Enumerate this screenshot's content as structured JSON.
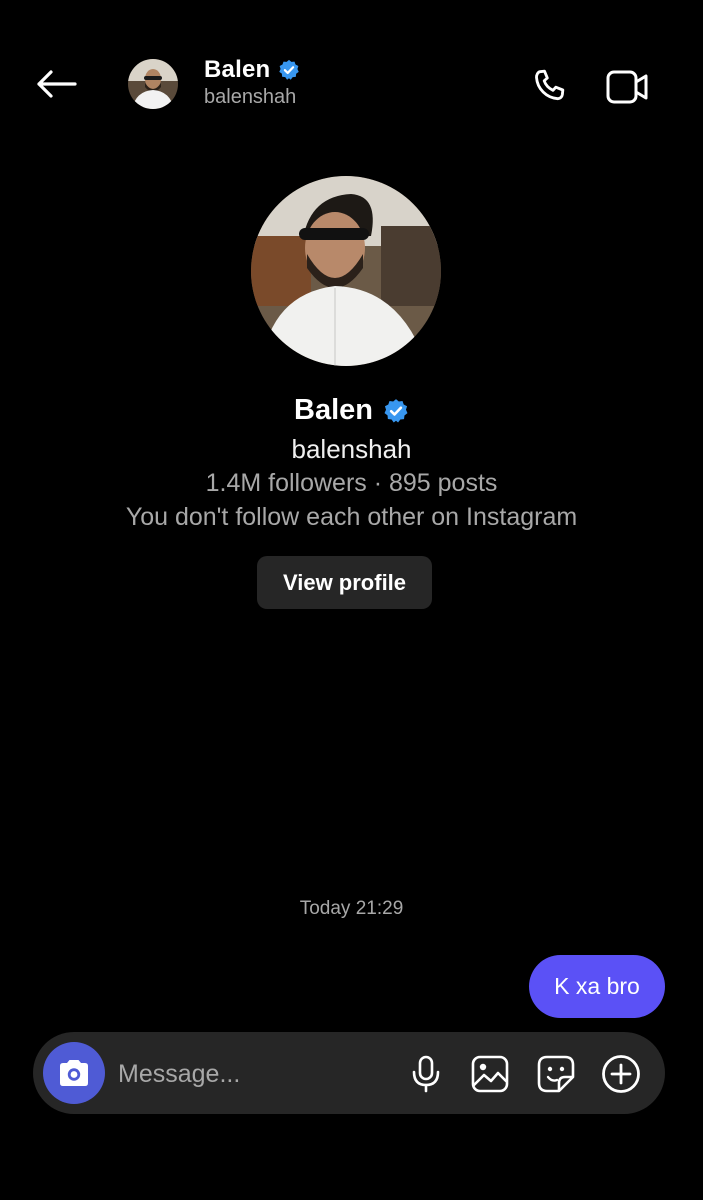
{
  "header": {
    "name": "Balen",
    "username": "balenshah",
    "icons": {
      "back": "arrow-left-icon",
      "verified": "verified-badge-icon",
      "call": "phone-icon",
      "video": "video-camera-icon"
    }
  },
  "profile": {
    "name": "Balen",
    "username": "balenshah",
    "stats": "1.4M followers · 895 posts",
    "note": "You don't follow each other on Instagram",
    "view_profile_label": "View profile"
  },
  "messages": {
    "timestamp": "Today 21:29",
    "items": [
      {
        "text": "K xa bro",
        "sender": "me"
      }
    ]
  },
  "composer": {
    "placeholder": "Message...",
    "icons": [
      "camera-icon",
      "microphone-icon",
      "gallery-icon",
      "sticker-icon",
      "plus-circle-icon"
    ]
  },
  "colors": {
    "background": "#000000",
    "bubble": "#5b51f6",
    "camera_button": "#4f5bd5",
    "verified": "#3897f0",
    "surface": "#262626",
    "muted_text": "#a8a8a8"
  }
}
